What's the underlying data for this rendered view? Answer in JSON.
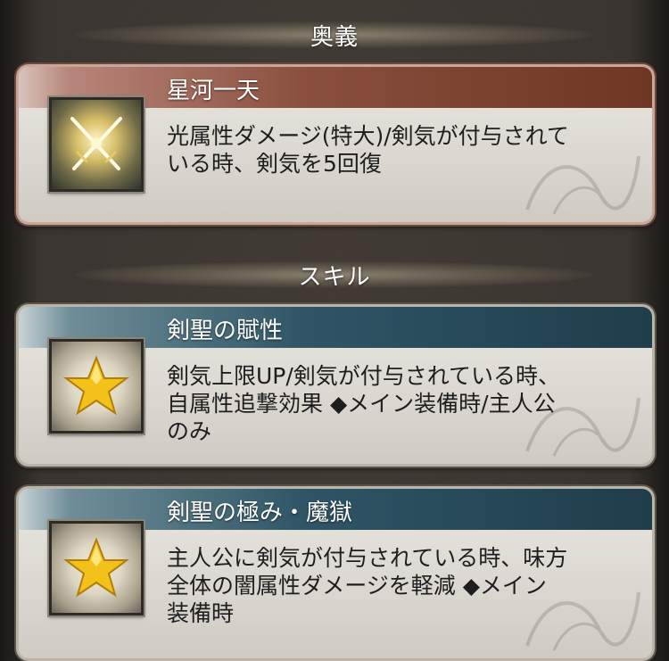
{
  "sections": {
    "ougi_label": "奥義",
    "skill_label": "スキル"
  },
  "ougi": {
    "name": "星河一天",
    "desc_line1": "光属性ダメージ(特大)/剣気が付与されて",
    "desc_line2": "いる時、剣気を5回復",
    "icon": "crossed-swords-icon"
  },
  "skills": [
    {
      "name": "剣聖の賦性",
      "desc_line1": "剣気上限UP/剣気が付与されている時、",
      "desc_line2": "自属性追撃効果 ◆メイン装備時/主人公",
      "desc_line3": "のみ",
      "icon": "star-icon"
    },
    {
      "name": "剣聖の極み・魔獄",
      "desc_line1": "主人公に剣気が付与されている時、味方",
      "desc_line2": "全体の闇属性ダメージを軽減 ◆メイン",
      "desc_line3": "装備時",
      "icon": "star-icon"
    }
  ],
  "colors": {
    "ougi_bar": "#8a4f3e",
    "skill_bar": "#2f5566",
    "star": "#f2c21a"
  }
}
